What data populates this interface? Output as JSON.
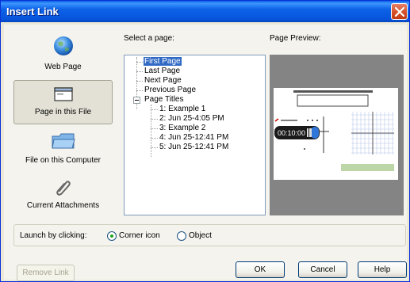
{
  "window": {
    "title": "Insert Link"
  },
  "nav": {
    "items": [
      {
        "label": "Web Page",
        "icon": "globe-icon"
      },
      {
        "label": "Page in this File",
        "icon": "page-icon"
      },
      {
        "label": "File on this Computer",
        "icon": "folder-icon"
      },
      {
        "label": "Current Attachments",
        "icon": "paperclip-icon"
      }
    ],
    "selected": "Page in this File"
  },
  "select_page": {
    "label": "Select a page:",
    "tree": [
      {
        "label": "First Page",
        "selected": true
      },
      {
        "label": "Last Page"
      },
      {
        "label": "Next Page"
      },
      {
        "label": "Previous Page"
      },
      {
        "label": "Page Titles",
        "expanded": true
      },
      {
        "label": "1: Example 1"
      },
      {
        "label": "2: Jun 25-4:05 PM"
      },
      {
        "label": "3: Example 2"
      },
      {
        "label": "4: Jun 25-12:41 PM"
      },
      {
        "label": "5: Jun 25-12:41 PM"
      }
    ]
  },
  "preview": {
    "label": "Page Preview:",
    "timer_text": "00:10:00"
  },
  "launch": {
    "label": "Launch by clicking:",
    "options": [
      {
        "label": "Corner icon",
        "checked": true
      },
      {
        "label": "Object",
        "checked": false
      }
    ]
  },
  "buttons": {
    "remove_link": "Remove Link",
    "ok": "OK",
    "cancel": "Cancel",
    "help": "Help"
  },
  "colors": {
    "title_bar": "#0855DD",
    "selection": "#316AC5",
    "radio_on": "#21A121"
  }
}
